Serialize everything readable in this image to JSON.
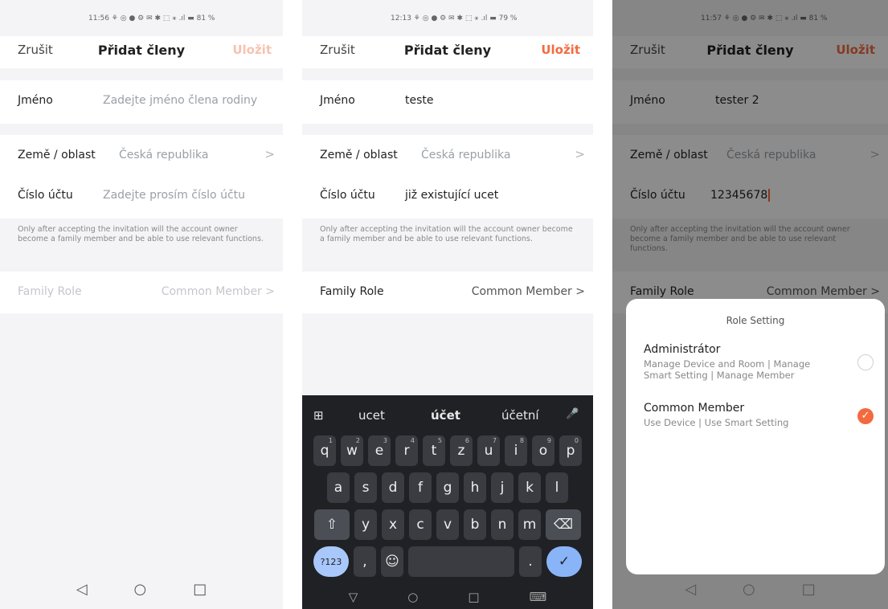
{
  "screens": [
    {
      "status": "11:56 ⚘ ◎ ● ⚙   ✉ ✱ ⬚ ⚹ .ıl ▬ 81 %",
      "nav": {
        "cancel": "Zrušit",
        "title": "Přidat členy",
        "save": "Uložit"
      },
      "name": {
        "label": "Jméno",
        "value": "Zadejte jméno člena rodiny"
      },
      "country": {
        "label": "Země / oblast",
        "value": "Česká republika",
        "chevron": ">"
      },
      "account": {
        "label": "Číslo účtu",
        "value": "Zadejte prosím číslo účtu"
      },
      "note": "Only after accepting the invitation will the account owner become a family member and be able to use relevant functions.",
      "role": {
        "label": "Family Role",
        "value": "Common Member >"
      },
      "bottom_nav": [
        "◁",
        "○",
        "□"
      ]
    },
    {
      "status": "12:13 ⚘ ◎ ● ⚙   ✉ ✱ ⬚ ⚹ .ıl ▬ 79 %",
      "nav": {
        "cancel": "Zrušit",
        "title": "Přidat členy",
        "save": "Uložit"
      },
      "name": {
        "label": "Jméno",
        "value": "teste"
      },
      "country": {
        "label": "Země / oblast",
        "value": "Česká republika",
        "chevron": ">"
      },
      "account": {
        "label": "Číslo účtu",
        "value": "již existující ucet"
      },
      "note": "Only after accepting the invitation will the account owner become a family member and be able to use relevant functions.",
      "role": {
        "label": "Family Role",
        "value": "Common Member >"
      },
      "keyboard": {
        "suggestions": [
          "ucet",
          "účet",
          "účetní"
        ],
        "apps_icon": "⊞",
        "mic_icon": "🎤",
        "row1": [
          "q",
          "w",
          "e",
          "r",
          "t",
          "z",
          "u",
          "i",
          "o",
          "p"
        ],
        "row1_nums": [
          "1",
          "2",
          "3",
          "4",
          "5",
          "6",
          "7",
          "8",
          "9",
          "0"
        ],
        "row2": [
          "a",
          "s",
          "d",
          "f",
          "g",
          "h",
          "j",
          "k",
          "l"
        ],
        "row3": [
          "y",
          "x",
          "c",
          "v",
          "b",
          "n",
          "m"
        ],
        "shift": "⇧",
        "backspace": "⌫",
        "num_key": "?123",
        "comma": ",",
        "emoji": "☺",
        "period": ".",
        "enter": "✓",
        "nav": [
          "▽",
          "○",
          "□",
          "⌨"
        ]
      }
    },
    {
      "status": "11:57 ⚘ ◎ ● ⚙   ✉ ✱ ⬚ ⚹ .ıl ▬ 81 %",
      "nav": {
        "cancel": "Zrušit",
        "title": "Přidat členy",
        "save": "Uložit"
      },
      "name": {
        "label": "Jméno",
        "value": "tester 2"
      },
      "country": {
        "label": "Země / oblast",
        "value": "Česká republika",
        "chevron": ">"
      },
      "account": {
        "label": "Číslo účtu",
        "value": "12345678"
      },
      "note": "Only after accepting the invitation will the account owner become a family member and be able to use relevant functions.",
      "role": {
        "label": "Family Role",
        "value": "Common Member >"
      },
      "sheet": {
        "title": "Role Setting",
        "options": [
          {
            "name": "Administrátor",
            "desc": "Manage Device and Room | Manage Smart Setting | Manage Member",
            "selected": false
          },
          {
            "name": "Common Member",
            "desc": "Use Device | Use Smart Setting",
            "selected": true
          }
        ],
        "check": "✓"
      },
      "bottom_nav": [
        "◁",
        "○",
        "□"
      ]
    }
  ],
  "colors": {
    "accent": "#f46a3f"
  }
}
